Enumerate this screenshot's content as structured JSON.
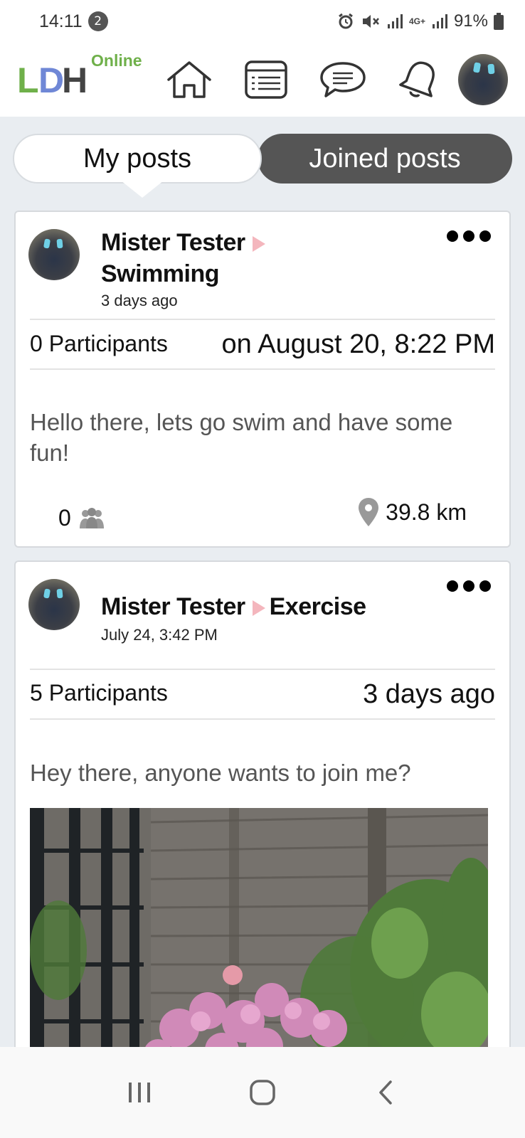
{
  "status_bar": {
    "time": "14:11",
    "notification_count": "2",
    "network_label": "4G+",
    "battery": "91%"
  },
  "header": {
    "logo_l": "L",
    "logo_d": "D",
    "logo_h": "H",
    "logo_sub": "Online",
    "nav": [
      "home-icon",
      "list-icon",
      "chat-icon",
      "bell-icon"
    ]
  },
  "tabs": {
    "my_posts": "My posts",
    "joined_posts": "Joined posts"
  },
  "posts": [
    {
      "author": "Mister Tester",
      "category": "Swimming",
      "time": "3 days ago",
      "participants": "0 Participants",
      "event_when": "on August 20, 8:22 PM",
      "body": "Hello there, lets go swim and have some fun!",
      "joined": "0",
      "distance": "39.8 km"
    },
    {
      "author": "Mister Tester",
      "category": "Exercise",
      "time": "July 24, 3:42 PM",
      "participants": "5 Participants",
      "event_when": "3 days ago",
      "body": "Hey there, anyone wants to join me?"
    }
  ],
  "colors": {
    "logo_green": "#6fb04a",
    "logo_blue": "#6f87d6",
    "active_tab": "#555555",
    "arrow_pink": "#f4b6bd",
    "background": "#e9edf1"
  }
}
